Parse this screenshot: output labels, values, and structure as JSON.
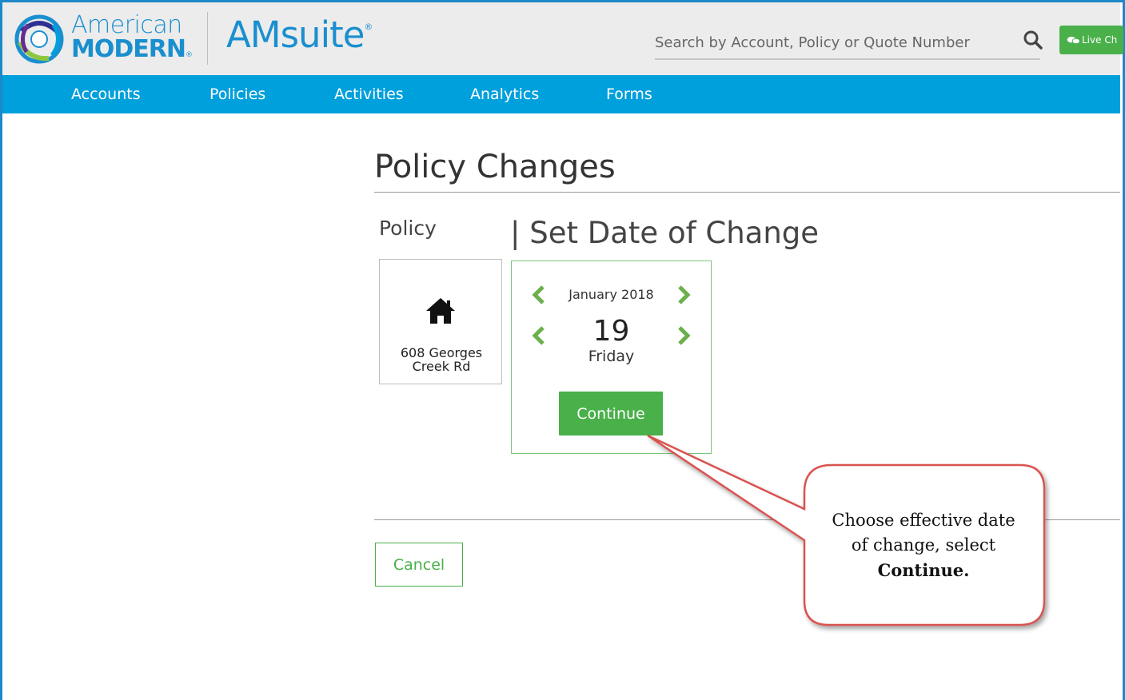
{
  "header": {
    "brand_line1": "American",
    "brand_line2": "MODERN",
    "brand_mark": "®",
    "product_name": "AMsuite",
    "product_mark": "®",
    "search_placeholder": "Search by Account, Policy or Quote Number",
    "live_chat_label": "Live Ch"
  },
  "nav": {
    "items": [
      {
        "label": "Accounts"
      },
      {
        "label": "Policies"
      },
      {
        "label": "Activities"
      },
      {
        "label": "Analytics"
      },
      {
        "label": "Forms"
      }
    ]
  },
  "main": {
    "page_title": "Policy Changes",
    "policy_label": "Policy",
    "step_title": "| Set Date of Change",
    "policy_card": {
      "icon": "house-icon",
      "address_line1": "608 Georges",
      "address_line2": "Creek Rd"
    },
    "date_picker": {
      "month": "January 2018",
      "day": "19",
      "weekday": "Friday"
    },
    "continue_label": "Continue",
    "cancel_label": "Cancel"
  },
  "callout": {
    "line1": "Choose effective date",
    "line2": "of change, select",
    "line3": "Continue."
  },
  "colors": {
    "brand_blue": "#1a8fcf",
    "nav_blue": "#00a0dc",
    "action_green": "#49b04a",
    "callout_border": "#d9534f"
  }
}
